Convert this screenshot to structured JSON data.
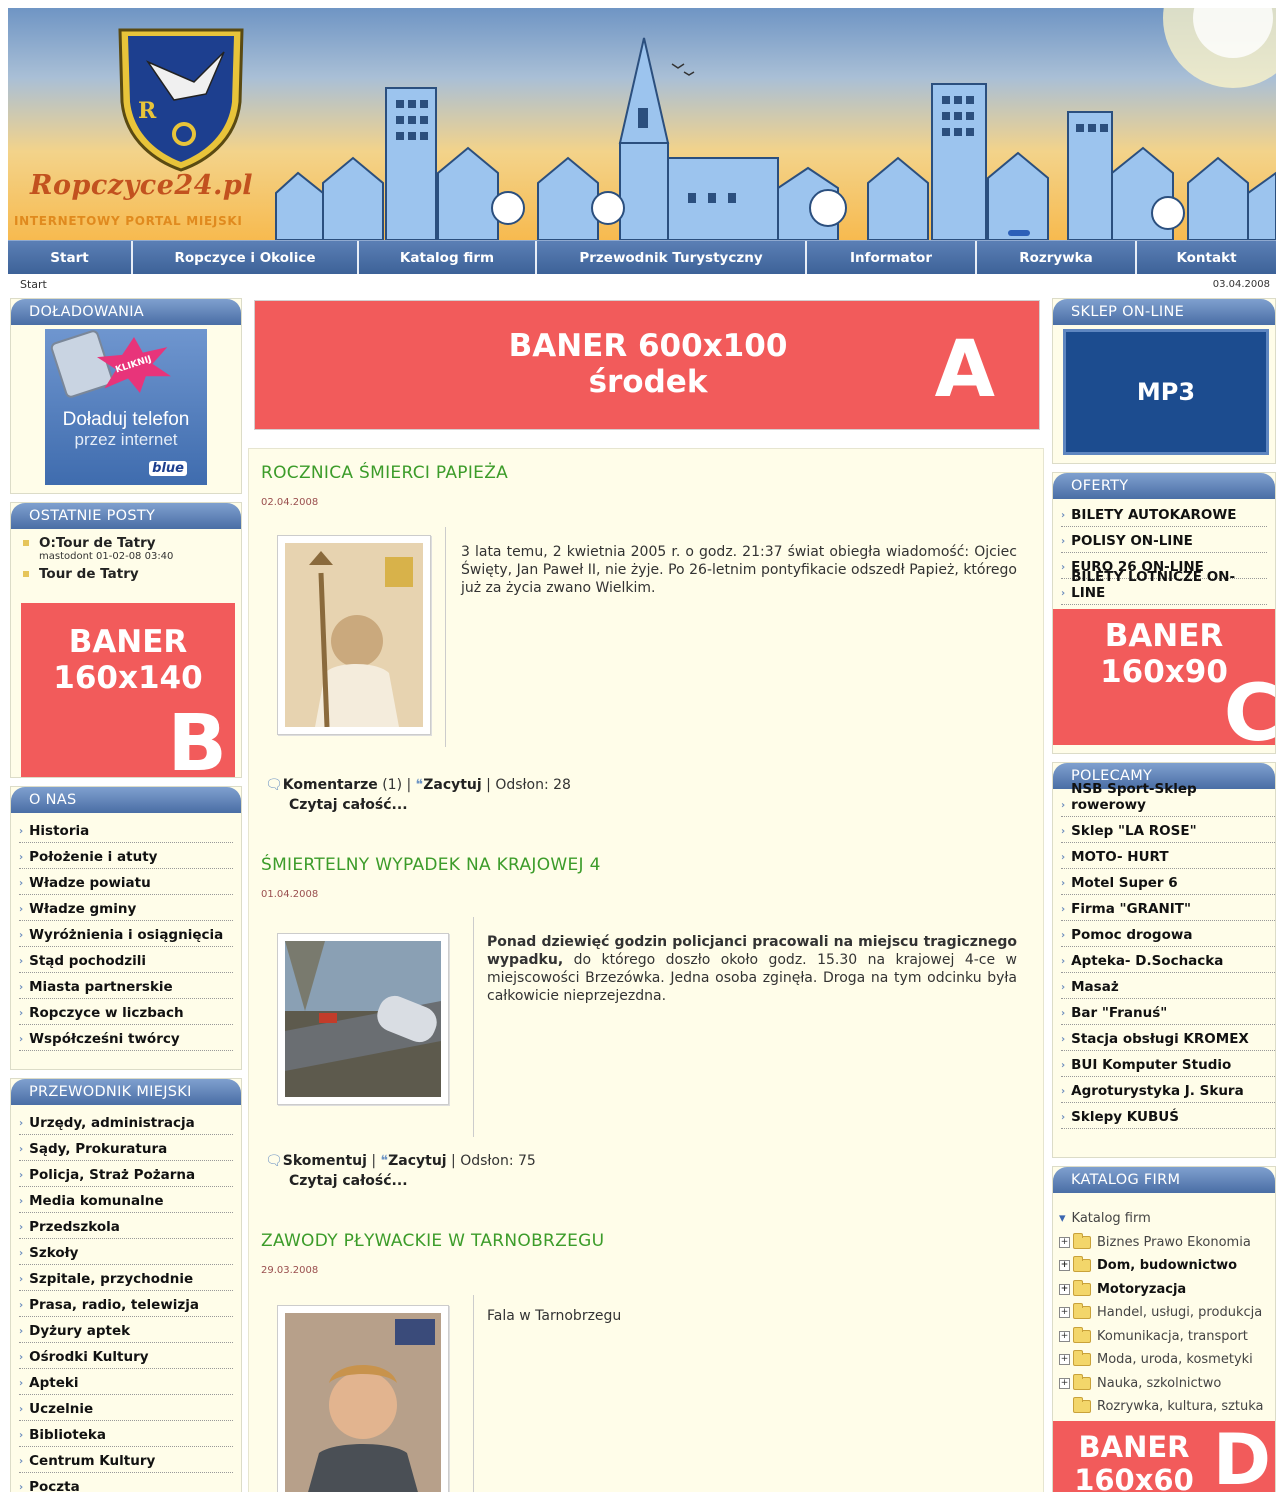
{
  "header": {
    "logo_text": "Ropczyce24.pl",
    "logo_subtitle": "INTERNETOWY PORTAL MIEJSKI",
    "crest_letter": "R"
  },
  "nav": {
    "items": [
      {
        "label": "Start"
      },
      {
        "label": "Ropczyce i Okolice"
      },
      {
        "label": "Katalog firm"
      },
      {
        "label": "Przewodnik Turystyczny"
      },
      {
        "label": "Informator"
      },
      {
        "label": "Rozrywka"
      },
      {
        "label": "Kontakt"
      }
    ]
  },
  "breadcrumb": "Start",
  "current_date": "03.04.2008",
  "left": {
    "doladowania": {
      "title": "DOŁADOWANIA",
      "promo_badge": "KLIKNIJ",
      "promo_line1": "Doładuj telefon",
      "promo_line2": "przez internet",
      "promo_brand": "blue"
    },
    "posts": {
      "title": "OSTATNIE POSTY",
      "items": [
        {
          "title": "O:Tour de Tatry",
          "meta": "mastodont 01-02-08 03:40"
        },
        {
          "title": "Tour de Tatry",
          "meta": ""
        }
      ]
    },
    "banner_b": {
      "line1": "BANER",
      "line2": "160x140",
      "letter": "B"
    },
    "onas": {
      "title": "O NAS",
      "items": [
        "Historia",
        "Położenie i atuty",
        "Władze powiatu",
        "Władze gminy",
        "Wyróżnienia i osiągnięcia",
        "Stąd pochodzili",
        "Miasta partnerskie",
        "Ropczyce w liczbach",
        "Współcześni twórcy"
      ]
    },
    "przewodnik": {
      "title": "PRZEWODNIK MIEJSKI",
      "items": [
        "Urzędy, administracja",
        "Sądy, Prokuratura",
        "Policja, Straż Pożarna",
        "Media komunalne",
        "Przedszkola",
        "Szkoły",
        "Szpitale, przychodnie",
        "Prasa, radio, telewizja",
        "Dyżury aptek",
        "Ośrodki Kultury",
        "Apteki",
        "Uczelnie",
        "Biblioteka",
        "Centrum Kultury",
        "Poczta"
      ]
    }
  },
  "center": {
    "banner_a": {
      "line1": "BANER 600x100",
      "line2": "środek",
      "letter": "A"
    },
    "articles": [
      {
        "title": "ROCZNICA ŚMIERCI PAPIEŻA",
        "date": "02.04.2008",
        "text": "3 lata temu, 2 kwietnia 2005 r. o godz. 21:37 świat obiegła wiadomość: Ojciec Święty, Jan Paweł II, nie żyje. Po 26-letnim pontyfikacie odszedł Papież, którego już za życia zwano Wielkim.",
        "comment_label": "Komentarze",
        "comment_count": "(1)",
        "quote_label": "Zacytuj",
        "views": "Odsłon: 28",
        "more": "Czytaj całość..."
      },
      {
        "title": "ŚMIERTELNY WYPADEK NA KRAJOWEJ 4",
        "date": "01.04.2008",
        "text_bold": "Ponad dziewięć godzin policjanci pracowali na miejscu tragicznego wypadku,",
        "text": " do którego doszło około godz. 15.30 na krajowej 4-ce w miejscowości Brzezówka. Jedna osoba zginęła. Droga na tym odcinku była całkowicie nieprzejezdna.",
        "comment_label": "Skomentuj",
        "quote_label": "Zacytuj",
        "views": "Odsłon: 75",
        "more": "Czytaj całość..."
      },
      {
        "title": "ZAWODY PŁYWACKIE W TARNOBRZEGU",
        "date": "29.03.2008",
        "text": "Fala w Tarnobrzegu"
      }
    ]
  },
  "right": {
    "sklep": {
      "title": "SKLEP ON-LINE",
      "label": "MP3"
    },
    "oferty": {
      "title": "OFERTY",
      "items": [
        "BILETY AUTOKAROWE",
        "POLISY ON-LINE",
        "EURO 26 ON-LINE",
        "BILETY LOTNICZE ON-LINE"
      ]
    },
    "banner_c": {
      "line1": "BANER",
      "line2": "160x90",
      "letter": "C"
    },
    "polecamy": {
      "title": "POLECAMY",
      "items": [
        "NSB Sport-Sklep rowerowy",
        "Sklep \"LA ROSE\"",
        "MOTO- HURT",
        "Motel Super 6",
        "Firma \"GRANIT\"",
        "Pomoc drogowa",
        "Apteka- D.Sochacka",
        "Masaż",
        "Bar \"Franuś\"",
        "Stacja obsługi KROMEX",
        "BUI Komputer Studio",
        "Agroturystyka J. Skura",
        "Sklepy KUBUŚ"
      ]
    },
    "katalog": {
      "title": "KATALOG FIRM",
      "root": "Katalog firm",
      "items": [
        {
          "label": "Biznes Prawo Ekonomia",
          "bold": false,
          "plus": true
        },
        {
          "label": "Dom, budownictwo",
          "bold": true,
          "plus": true
        },
        {
          "label": "Motoryzacja",
          "bold": true,
          "plus": true
        },
        {
          "label": "Handel, usługi, produkcja",
          "bold": false,
          "plus": true
        },
        {
          "label": "Komunikacja, transport",
          "bold": false,
          "plus": true
        },
        {
          "label": "Moda, uroda, kosmetyki",
          "bold": false,
          "plus": true
        },
        {
          "label": "Nauka, szkolnictwo",
          "bold": false,
          "plus": true
        },
        {
          "label": "Rozrywka, kultura, sztuka",
          "bold": false,
          "plus": false
        }
      ]
    },
    "banner_d": {
      "line1": "BANER",
      "line2": "160x60",
      "letter": "D"
    }
  }
}
